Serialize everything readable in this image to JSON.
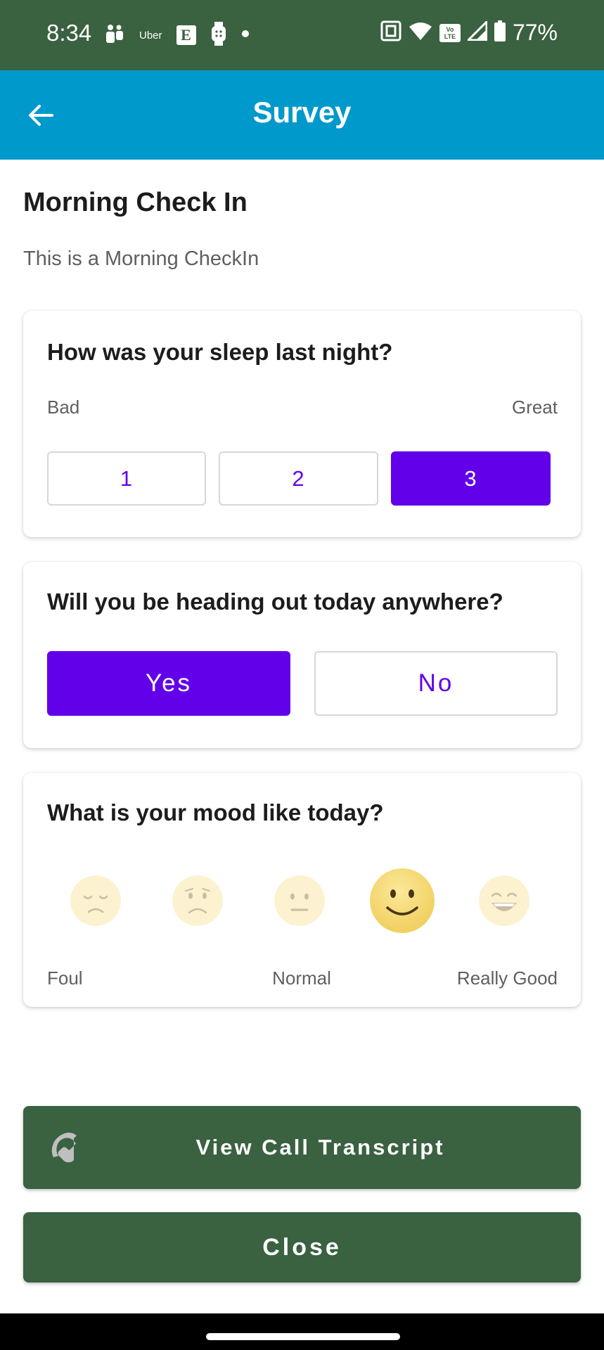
{
  "status_bar": {
    "time": "8:34",
    "uber_label": "Uber",
    "etsy_label": "E",
    "volte_label": "Vo LTE",
    "battery": "77%"
  },
  "app_bar": {
    "title": "Survey"
  },
  "survey": {
    "title": "Morning Check In",
    "description": "This is a Morning CheckIn"
  },
  "questions": [
    {
      "title": "How was your sleep last night?",
      "min_label": "Bad",
      "max_label": "Great",
      "options": [
        "1",
        "2",
        "3"
      ],
      "selected": "3"
    },
    {
      "title": "Will you be heading out today anywhere?",
      "options": [
        "Yes",
        "No"
      ],
      "selected": "Yes"
    },
    {
      "title": "What is your mood like today?",
      "moods": [
        "very-sad-face-icon",
        "sad-face-icon",
        "neutral-face-icon",
        "smiling-face-icon",
        "grinning-face-icon"
      ],
      "selected_index": 3,
      "labels": [
        "Foul",
        "Normal",
        "Really Good"
      ]
    }
  ],
  "buttons": {
    "transcript": "View Call Transcript",
    "close": "Close"
  },
  "colors": {
    "status_bar": "#3a6140",
    "app_bar": "#0099cc",
    "accent": "#6200ea",
    "action_button": "#3a6140",
    "emoji": "#f8e18a"
  }
}
